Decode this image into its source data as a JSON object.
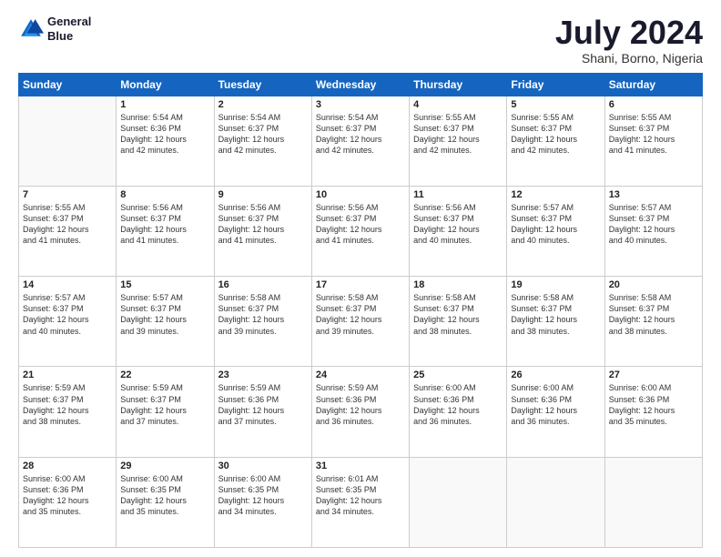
{
  "logo": {
    "line1": "General",
    "line2": "Blue"
  },
  "title": "July 2024",
  "location": "Shani, Borno, Nigeria",
  "days_of_week": [
    "Sunday",
    "Monday",
    "Tuesday",
    "Wednesday",
    "Thursday",
    "Friday",
    "Saturday"
  ],
  "weeks": [
    [
      {
        "day": "",
        "info": ""
      },
      {
        "day": "1",
        "info": "Sunrise: 5:54 AM\nSunset: 6:36 PM\nDaylight: 12 hours\nand 42 minutes."
      },
      {
        "day": "2",
        "info": "Sunrise: 5:54 AM\nSunset: 6:37 PM\nDaylight: 12 hours\nand 42 minutes."
      },
      {
        "day": "3",
        "info": "Sunrise: 5:54 AM\nSunset: 6:37 PM\nDaylight: 12 hours\nand 42 minutes."
      },
      {
        "day": "4",
        "info": "Sunrise: 5:55 AM\nSunset: 6:37 PM\nDaylight: 12 hours\nand 42 minutes."
      },
      {
        "day": "5",
        "info": "Sunrise: 5:55 AM\nSunset: 6:37 PM\nDaylight: 12 hours\nand 42 minutes."
      },
      {
        "day": "6",
        "info": "Sunrise: 5:55 AM\nSunset: 6:37 PM\nDaylight: 12 hours\nand 41 minutes."
      }
    ],
    [
      {
        "day": "7",
        "info": "Sunrise: 5:55 AM\nSunset: 6:37 PM\nDaylight: 12 hours\nand 41 minutes."
      },
      {
        "day": "8",
        "info": "Sunrise: 5:56 AM\nSunset: 6:37 PM\nDaylight: 12 hours\nand 41 minutes."
      },
      {
        "day": "9",
        "info": "Sunrise: 5:56 AM\nSunset: 6:37 PM\nDaylight: 12 hours\nand 41 minutes."
      },
      {
        "day": "10",
        "info": "Sunrise: 5:56 AM\nSunset: 6:37 PM\nDaylight: 12 hours\nand 41 minutes."
      },
      {
        "day": "11",
        "info": "Sunrise: 5:56 AM\nSunset: 6:37 PM\nDaylight: 12 hours\nand 40 minutes."
      },
      {
        "day": "12",
        "info": "Sunrise: 5:57 AM\nSunset: 6:37 PM\nDaylight: 12 hours\nand 40 minutes."
      },
      {
        "day": "13",
        "info": "Sunrise: 5:57 AM\nSunset: 6:37 PM\nDaylight: 12 hours\nand 40 minutes."
      }
    ],
    [
      {
        "day": "14",
        "info": "Sunrise: 5:57 AM\nSunset: 6:37 PM\nDaylight: 12 hours\nand 40 minutes."
      },
      {
        "day": "15",
        "info": "Sunrise: 5:57 AM\nSunset: 6:37 PM\nDaylight: 12 hours\nand 39 minutes."
      },
      {
        "day": "16",
        "info": "Sunrise: 5:58 AM\nSunset: 6:37 PM\nDaylight: 12 hours\nand 39 minutes."
      },
      {
        "day": "17",
        "info": "Sunrise: 5:58 AM\nSunset: 6:37 PM\nDaylight: 12 hours\nand 39 minutes."
      },
      {
        "day": "18",
        "info": "Sunrise: 5:58 AM\nSunset: 6:37 PM\nDaylight: 12 hours\nand 38 minutes."
      },
      {
        "day": "19",
        "info": "Sunrise: 5:58 AM\nSunset: 6:37 PM\nDaylight: 12 hours\nand 38 minutes."
      },
      {
        "day": "20",
        "info": "Sunrise: 5:58 AM\nSunset: 6:37 PM\nDaylight: 12 hours\nand 38 minutes."
      }
    ],
    [
      {
        "day": "21",
        "info": "Sunrise: 5:59 AM\nSunset: 6:37 PM\nDaylight: 12 hours\nand 38 minutes."
      },
      {
        "day": "22",
        "info": "Sunrise: 5:59 AM\nSunset: 6:37 PM\nDaylight: 12 hours\nand 37 minutes."
      },
      {
        "day": "23",
        "info": "Sunrise: 5:59 AM\nSunset: 6:36 PM\nDaylight: 12 hours\nand 37 minutes."
      },
      {
        "day": "24",
        "info": "Sunrise: 5:59 AM\nSunset: 6:36 PM\nDaylight: 12 hours\nand 36 minutes."
      },
      {
        "day": "25",
        "info": "Sunrise: 6:00 AM\nSunset: 6:36 PM\nDaylight: 12 hours\nand 36 minutes."
      },
      {
        "day": "26",
        "info": "Sunrise: 6:00 AM\nSunset: 6:36 PM\nDaylight: 12 hours\nand 36 minutes."
      },
      {
        "day": "27",
        "info": "Sunrise: 6:00 AM\nSunset: 6:36 PM\nDaylight: 12 hours\nand 35 minutes."
      }
    ],
    [
      {
        "day": "28",
        "info": "Sunrise: 6:00 AM\nSunset: 6:36 PM\nDaylight: 12 hours\nand 35 minutes."
      },
      {
        "day": "29",
        "info": "Sunrise: 6:00 AM\nSunset: 6:35 PM\nDaylight: 12 hours\nand 35 minutes."
      },
      {
        "day": "30",
        "info": "Sunrise: 6:00 AM\nSunset: 6:35 PM\nDaylight: 12 hours\nand 34 minutes."
      },
      {
        "day": "31",
        "info": "Sunrise: 6:01 AM\nSunset: 6:35 PM\nDaylight: 12 hours\nand 34 minutes."
      },
      {
        "day": "",
        "info": ""
      },
      {
        "day": "",
        "info": ""
      },
      {
        "day": "",
        "info": ""
      }
    ]
  ]
}
